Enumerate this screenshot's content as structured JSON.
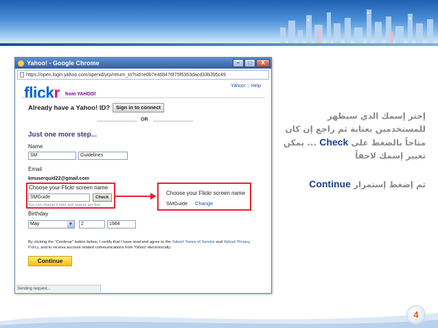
{
  "window": {
    "title": "Yahoo! - Google Chrome",
    "btn_minimize": "–",
    "btn_maximize": "□",
    "btn_close": "X",
    "url": "https://open.login.yahoo.com/openid/yrp/return_to?sid=e0b7e468476f75f6363dacd33b395c49",
    "status": "Sending request..."
  },
  "page": {
    "logo_part1": "flick",
    "logo_part2": "r",
    "from_yahoo": "from YAHOO!",
    "links": [
      "Yahoo!",
      "Help"
    ],
    "already_text": "Already have a Yahoo! ID?",
    "signin_label": "Sign in to connect",
    "or_text": "OR",
    "step_heading": "Just one more step...",
    "name_label": "Name",
    "first_name": "SM",
    "last_name": "Guidelines",
    "email_label": "Email",
    "email_value": "kmuserquid22@gmail.com",
    "screen_name_label": "Choose your Flickr screen name",
    "screen_name_value": "SMGuide",
    "check_label": "Check",
    "hint": "You can change it later and spaces are fine.",
    "birthday_label": "Birthday",
    "birth_month": "May",
    "birth_day": "2",
    "birth_year": "1984",
    "legal_prefix": "By clicking the \"Continue\" button below, I certify that I have read and agree to the ",
    "legal_link1": "Yahoo! Terms of Service",
    "legal_mid": " and ",
    "legal_link2": "Yahoo! Privacy Policy",
    "legal_suffix": ", and to receive account related communications from Yahoo! electronically.",
    "continue_label": "Continue"
  },
  "callout": {
    "title": "Choose your Flickr screen name",
    "value": "SMGuide",
    "change_link": "Change"
  },
  "arabic": {
    "para1_part1": "إختر إسمك الذي سيظهر للمستخدمين بعناية ثم راجع إن كان متاحاً بالضغط على",
    "para1_keyword": "Check",
    "para1_part2": "... يمكن تغيير إسمك لاحقاً",
    "para2_part1": "ثم إضغط إستمرار",
    "para2_keyword": "Continue"
  },
  "page_number": "4",
  "colors": {
    "highlight_red": "#e8202a",
    "flickr_blue": "#0063dc",
    "flickr_pink": "#ff0084",
    "keyword_blue": "#1c3f8c",
    "arabic_gray": "#8a8a8a",
    "page_number_orange": "#e05a00"
  }
}
